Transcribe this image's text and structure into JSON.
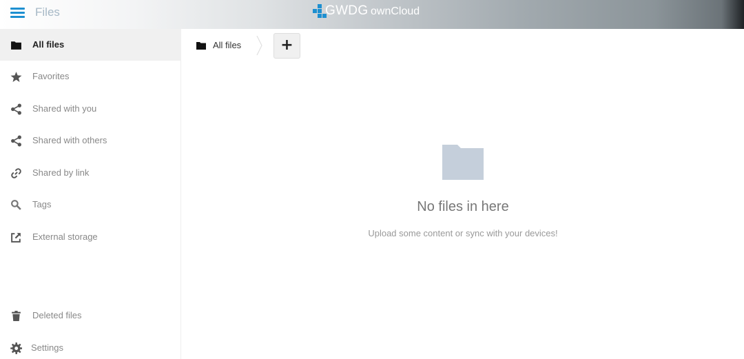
{
  "header": {
    "app_name": "Files",
    "logo_brand": "GWDG",
    "logo_product": "ownCloud"
  },
  "sidebar": {
    "items": [
      {
        "label": "All files",
        "icon": "folder-icon",
        "active": true
      },
      {
        "label": "Favorites",
        "icon": "star-icon"
      },
      {
        "label": "Shared with you",
        "icon": "share-icon"
      },
      {
        "label": "Shared with others",
        "icon": "share-icon"
      },
      {
        "label": "Shared by link",
        "icon": "link-icon"
      },
      {
        "label": "Tags",
        "icon": "search-icon"
      },
      {
        "label": "External storage",
        "icon": "external-link-icon"
      }
    ],
    "deleted": {
      "label": "Deleted files",
      "icon": "trash-icon"
    },
    "settings": {
      "label": "Settings",
      "icon": "gear-icon"
    }
  },
  "breadcrumb": {
    "label": "All files"
  },
  "toolbar": {
    "new_label": "+"
  },
  "empty": {
    "title": "No files in here",
    "hint": "Upload some content or sync with your devices!"
  },
  "colors": {
    "accent": "#1d8fd0",
    "folder": "#c5cfdb",
    "active_bg": "#f0f0f0"
  }
}
